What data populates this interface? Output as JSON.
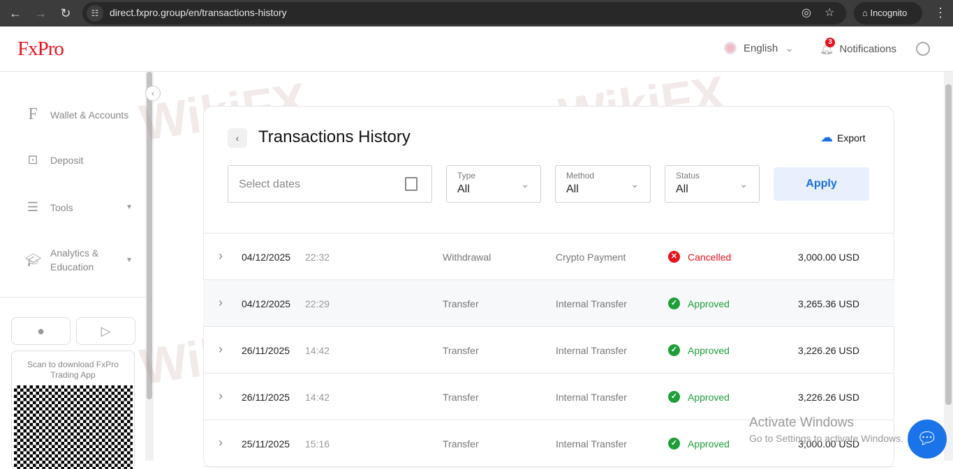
{
  "browser": {
    "url": "direct.fxpro.group/en/transactions-history",
    "incognito": "Incognito"
  },
  "header": {
    "logo": "FxPro",
    "language": "English",
    "notifications": "Notifications",
    "notification_count": "3"
  },
  "sidebar": {
    "items": [
      {
        "label": "Wallet & Accounts"
      },
      {
        "label": "Deposit"
      },
      {
        "label": "Tools"
      },
      {
        "label": "Analytics & Education"
      }
    ],
    "qr_text": "Scan to download FxPro Trading App"
  },
  "main": {
    "title": "Transactions History",
    "export": "Export",
    "filters": {
      "dates_placeholder": "Select dates",
      "type_label": "Type",
      "type_value": "All",
      "method_label": "Method",
      "method_value": "All",
      "status_label": "Status",
      "status_value": "All",
      "apply": "Apply"
    },
    "rows": [
      {
        "date": "04/12/2025",
        "time": "22:32",
        "type": "Withdrawal",
        "method": "Crypto Payment",
        "status": "Cancelled",
        "amount": "3,000.00 USD"
      },
      {
        "date": "04/12/2025",
        "time": "22:29",
        "type": "Transfer",
        "method": "Internal Transfer",
        "status": "Approved",
        "amount": "3,265.36 USD"
      },
      {
        "date": "26/11/2025",
        "time": "14:42",
        "type": "Transfer",
        "method": "Internal Transfer",
        "status": "Approved",
        "amount": "3,226.26 USD"
      },
      {
        "date": "26/11/2025",
        "time": "14:42",
        "type": "Transfer",
        "method": "Internal Transfer",
        "status": "Approved",
        "amount": "3,226.26 USD"
      },
      {
        "date": "25/11/2025",
        "time": "15:16",
        "type": "Transfer",
        "method": "Internal Transfer",
        "status": "Approved",
        "amount": "3,000.00 USD"
      }
    ]
  },
  "colors": {
    "approved": "#1e9e3a",
    "cancelled": "#e8121d",
    "accent": "#1a6fe0"
  },
  "watermark": "WikiFX",
  "os_overlay": {
    "title": "Activate Windows",
    "subtitle": "Go to Settings to activate Windows."
  }
}
